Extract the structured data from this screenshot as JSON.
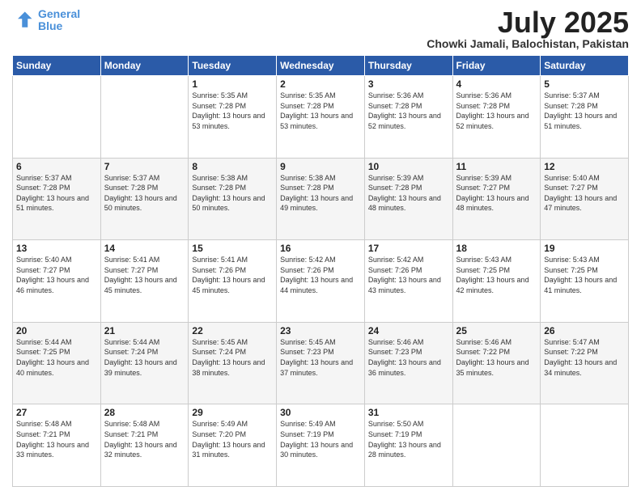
{
  "logo": {
    "line1": "General",
    "line2": "Blue"
  },
  "title": "July 2025",
  "subtitle": "Chowki Jamali, Balochistan, Pakistan",
  "weekdays": [
    "Sunday",
    "Monday",
    "Tuesday",
    "Wednesday",
    "Thursday",
    "Friday",
    "Saturday"
  ],
  "weeks": [
    [
      {
        "day": "",
        "info": ""
      },
      {
        "day": "",
        "info": ""
      },
      {
        "day": "1",
        "info": "Sunrise: 5:35 AM\nSunset: 7:28 PM\nDaylight: 13 hours and 53 minutes."
      },
      {
        "day": "2",
        "info": "Sunrise: 5:35 AM\nSunset: 7:28 PM\nDaylight: 13 hours and 53 minutes."
      },
      {
        "day": "3",
        "info": "Sunrise: 5:36 AM\nSunset: 7:28 PM\nDaylight: 13 hours and 52 minutes."
      },
      {
        "day": "4",
        "info": "Sunrise: 5:36 AM\nSunset: 7:28 PM\nDaylight: 13 hours and 52 minutes."
      },
      {
        "day": "5",
        "info": "Sunrise: 5:37 AM\nSunset: 7:28 PM\nDaylight: 13 hours and 51 minutes."
      }
    ],
    [
      {
        "day": "6",
        "info": "Sunrise: 5:37 AM\nSunset: 7:28 PM\nDaylight: 13 hours and 51 minutes."
      },
      {
        "day": "7",
        "info": "Sunrise: 5:37 AM\nSunset: 7:28 PM\nDaylight: 13 hours and 50 minutes."
      },
      {
        "day": "8",
        "info": "Sunrise: 5:38 AM\nSunset: 7:28 PM\nDaylight: 13 hours and 50 minutes."
      },
      {
        "day": "9",
        "info": "Sunrise: 5:38 AM\nSunset: 7:28 PM\nDaylight: 13 hours and 49 minutes."
      },
      {
        "day": "10",
        "info": "Sunrise: 5:39 AM\nSunset: 7:28 PM\nDaylight: 13 hours and 48 minutes."
      },
      {
        "day": "11",
        "info": "Sunrise: 5:39 AM\nSunset: 7:27 PM\nDaylight: 13 hours and 48 minutes."
      },
      {
        "day": "12",
        "info": "Sunrise: 5:40 AM\nSunset: 7:27 PM\nDaylight: 13 hours and 47 minutes."
      }
    ],
    [
      {
        "day": "13",
        "info": "Sunrise: 5:40 AM\nSunset: 7:27 PM\nDaylight: 13 hours and 46 minutes."
      },
      {
        "day": "14",
        "info": "Sunrise: 5:41 AM\nSunset: 7:27 PM\nDaylight: 13 hours and 45 minutes."
      },
      {
        "day": "15",
        "info": "Sunrise: 5:41 AM\nSunset: 7:26 PM\nDaylight: 13 hours and 45 minutes."
      },
      {
        "day": "16",
        "info": "Sunrise: 5:42 AM\nSunset: 7:26 PM\nDaylight: 13 hours and 44 minutes."
      },
      {
        "day": "17",
        "info": "Sunrise: 5:42 AM\nSunset: 7:26 PM\nDaylight: 13 hours and 43 minutes."
      },
      {
        "day": "18",
        "info": "Sunrise: 5:43 AM\nSunset: 7:25 PM\nDaylight: 13 hours and 42 minutes."
      },
      {
        "day": "19",
        "info": "Sunrise: 5:43 AM\nSunset: 7:25 PM\nDaylight: 13 hours and 41 minutes."
      }
    ],
    [
      {
        "day": "20",
        "info": "Sunrise: 5:44 AM\nSunset: 7:25 PM\nDaylight: 13 hours and 40 minutes."
      },
      {
        "day": "21",
        "info": "Sunrise: 5:44 AM\nSunset: 7:24 PM\nDaylight: 13 hours and 39 minutes."
      },
      {
        "day": "22",
        "info": "Sunrise: 5:45 AM\nSunset: 7:24 PM\nDaylight: 13 hours and 38 minutes."
      },
      {
        "day": "23",
        "info": "Sunrise: 5:45 AM\nSunset: 7:23 PM\nDaylight: 13 hours and 37 minutes."
      },
      {
        "day": "24",
        "info": "Sunrise: 5:46 AM\nSunset: 7:23 PM\nDaylight: 13 hours and 36 minutes."
      },
      {
        "day": "25",
        "info": "Sunrise: 5:46 AM\nSunset: 7:22 PM\nDaylight: 13 hours and 35 minutes."
      },
      {
        "day": "26",
        "info": "Sunrise: 5:47 AM\nSunset: 7:22 PM\nDaylight: 13 hours and 34 minutes."
      }
    ],
    [
      {
        "day": "27",
        "info": "Sunrise: 5:48 AM\nSunset: 7:21 PM\nDaylight: 13 hours and 33 minutes."
      },
      {
        "day": "28",
        "info": "Sunrise: 5:48 AM\nSunset: 7:21 PM\nDaylight: 13 hours and 32 minutes."
      },
      {
        "day": "29",
        "info": "Sunrise: 5:49 AM\nSunset: 7:20 PM\nDaylight: 13 hours and 31 minutes."
      },
      {
        "day": "30",
        "info": "Sunrise: 5:49 AM\nSunset: 7:19 PM\nDaylight: 13 hours and 30 minutes."
      },
      {
        "day": "31",
        "info": "Sunrise: 5:50 AM\nSunset: 7:19 PM\nDaylight: 13 hours and 28 minutes."
      },
      {
        "day": "",
        "info": ""
      },
      {
        "day": "",
        "info": ""
      }
    ]
  ]
}
